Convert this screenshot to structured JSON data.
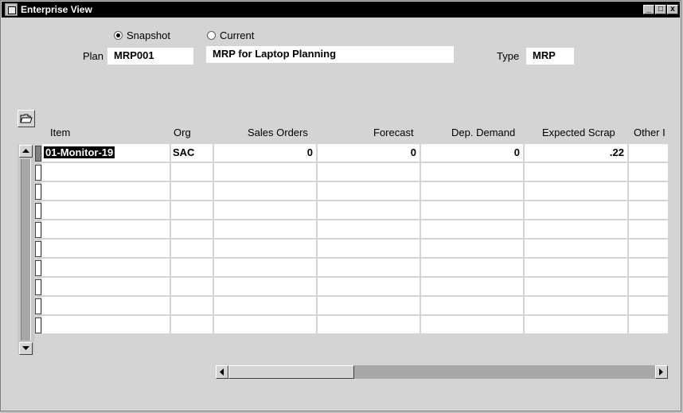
{
  "window": {
    "title": "Enterprise View",
    "minimize_label": "_",
    "maximize_label": "□",
    "close_label": "x"
  },
  "view_mode": {
    "snapshot_label": "Snapshot",
    "current_label": "Current",
    "selected": "Snapshot"
  },
  "plan": {
    "label": "Plan",
    "value": "MRP001",
    "description": "MRP for Laptop Planning",
    "type_label": "Type",
    "type_value": "MRP"
  },
  "table": {
    "columns": [
      "Item",
      "Org",
      "Sales Orders",
      "Forecast",
      "Dep. Demand",
      "Expected Scrap",
      "Other I"
    ],
    "rows": [
      {
        "item": "01-Monitor-19",
        "org": "SAC",
        "sales_orders": "0",
        "forecast": "0",
        "dep_demand": "0",
        "expected_scrap": ".22",
        "other": ""
      }
    ],
    "empty_rows": 9
  },
  "icons": {
    "open_folder": "open-folder-icon",
    "scroll_up": "arrow-up-icon",
    "scroll_down": "arrow-down-icon",
    "scroll_left": "arrow-left-icon",
    "scroll_right": "arrow-right-icon"
  }
}
